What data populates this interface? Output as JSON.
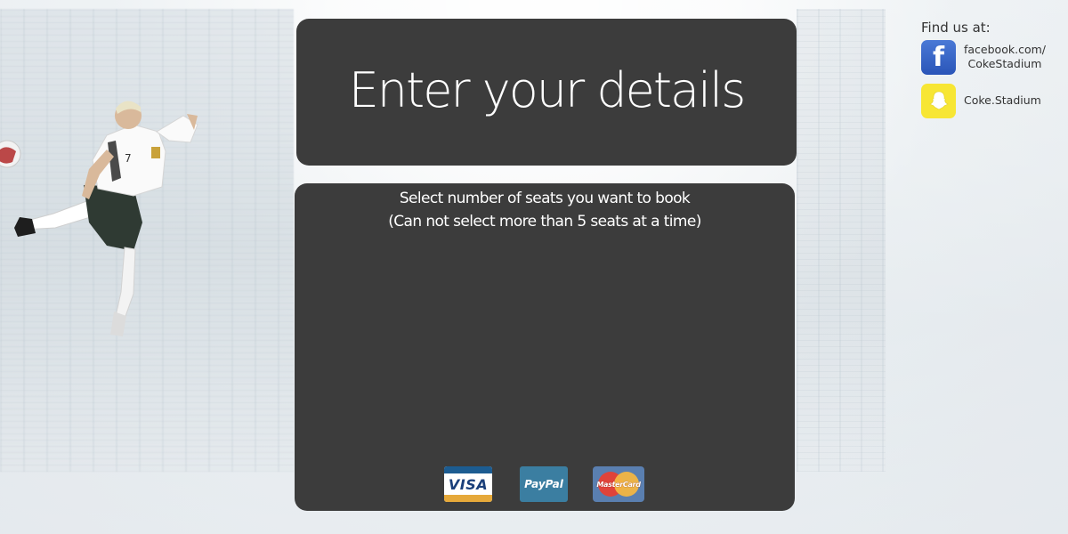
{
  "header": {
    "title": "Enter your details"
  },
  "booking": {
    "instruction_line1": "Select number of seats you want to book",
    "instruction_line2": "(Can not select more than 5 seats at a time)"
  },
  "payments": {
    "visa_label": "VISA",
    "paypal_label": "PayPal",
    "mastercard_label": "MasterCard"
  },
  "social": {
    "heading": "Find us at:",
    "facebook_line1": "facebook.com/",
    "facebook_line2": "CokeStadium",
    "snapchat_label": "Coke.Stadium",
    "facebook_icon": "facebook-icon",
    "snapchat_icon": "snapchat-ghost-icon"
  },
  "colors": {
    "panel_bg": "#3c3c3c",
    "page_bg": "#e8ecef",
    "facebook_blue": "#3b66c4",
    "snapchat_yellow": "#f7e634"
  }
}
